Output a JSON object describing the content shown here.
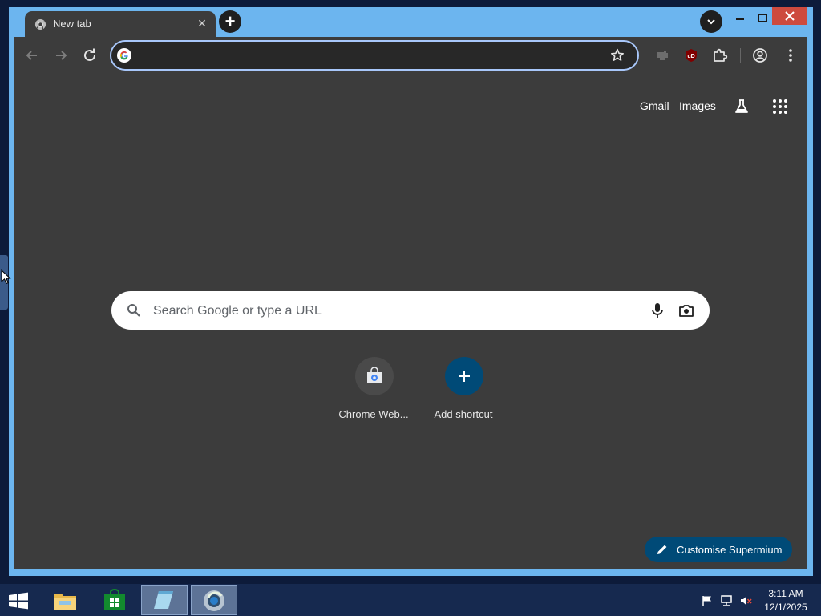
{
  "tab": {
    "title": "New tab",
    "icon": "chromium-icon"
  },
  "omnibox": {
    "value": ""
  },
  "header_links": {
    "gmail": "Gmail",
    "images": "Images"
  },
  "search": {
    "placeholder": "Search Google or type a URL"
  },
  "shortcuts": [
    {
      "label": "Chrome Web...",
      "icon": "chrome-web-store-icon"
    },
    {
      "label": "Add shortcut",
      "icon": "plus-icon"
    }
  ],
  "customise_button": {
    "label": "Customise Supermium"
  },
  "clock": {
    "time": "3:11 AM",
    "date": "12/1/2025"
  },
  "colors": {
    "window_frame": "#6cb5ef",
    "browser_bg": "#3c3c3c",
    "accent": "#004a77",
    "omnibox_border": "#a8c7fa",
    "close_button": "#cd4a3e",
    "taskbar": "#16294f"
  }
}
